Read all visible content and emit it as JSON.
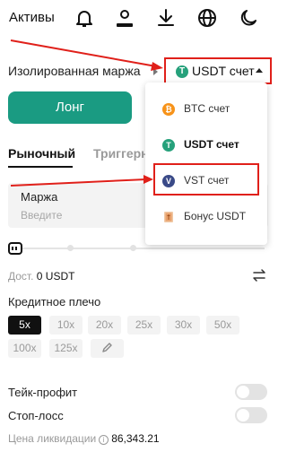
{
  "header": {
    "title": "Активы",
    "icons": [
      "bell-icon",
      "user-icon",
      "download-icon",
      "globe-icon",
      "moon-icon"
    ]
  },
  "margin_mode": {
    "label": "Изолированная маржа"
  },
  "account_selector": {
    "label": "USDT счет",
    "coin_letter": "T"
  },
  "side": {
    "long_label": "Лонг"
  },
  "order_tabs": {
    "market": "Рыночный",
    "trigger": "Триггерн"
  },
  "margin_field": {
    "label": "Маржа",
    "placeholder": "Введите"
  },
  "leverage_slider": {
    "value": 0
  },
  "available": {
    "label": "Дост.",
    "value": "0 USDT"
  },
  "leverage": {
    "title": "Кредитное плечо",
    "options": [
      "5x",
      "10x",
      "20x",
      "25x",
      "30x",
      "50x",
      "100x",
      "125x"
    ],
    "selected": "5x"
  },
  "take_profit": {
    "label": "Тейк-профит",
    "enabled": false
  },
  "stop_loss": {
    "label": "Стоп-лосс",
    "enabled": false
  },
  "liquidation": {
    "label": "Цена ликвидации",
    "info": "i",
    "value": "86,343.21"
  },
  "dropdown": {
    "items": [
      {
        "label": "BTC счет",
        "coin": "btc",
        "letter": "₿"
      },
      {
        "label": "USDT счет",
        "coin": "usdt",
        "letter": "T",
        "selected": true
      },
      {
        "label": "VST счет",
        "coin": "vst",
        "letter": "V",
        "highlighted": true
      },
      {
        "label": "Бонус USDT",
        "coin": "bonus"
      }
    ]
  },
  "colors": {
    "accent_green": "#1a9b82",
    "usdt_green": "#26a17b",
    "btc_orange": "#f7931a",
    "vst_navy": "#3a4a88",
    "annotation_red": "#e0201a"
  }
}
